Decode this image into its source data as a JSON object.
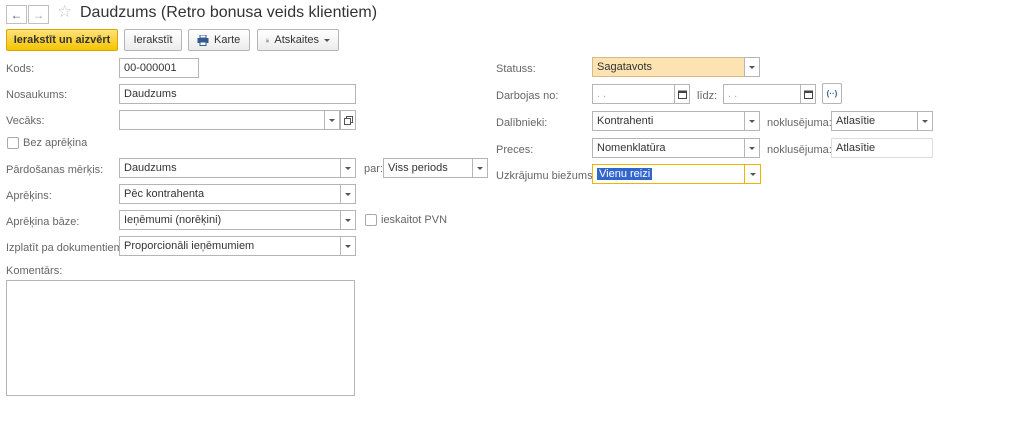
{
  "window": {
    "title": "Daudzums (Retro bonusa veids klientiem)"
  },
  "toolbar": {
    "save_close": "Ierakstīt un aizvērt",
    "save": "Ierakstīt",
    "print": "Karte",
    "reports": "Atskaites"
  },
  "left": {
    "code_label": "Kods:",
    "code_value": "00-000001",
    "name_label": "Nosaukums:",
    "name_value": "Daudzums",
    "parent_label": "Vecāks:",
    "parent_value": "",
    "no_calc_label": "Bez aprēķina",
    "sales_goal_label": "Pārdošanas mērķis:",
    "sales_goal_value": "Daudzums",
    "par_label": "par:",
    "par_value": "Viss periods",
    "calc_label": "Aprēķins:",
    "calc_value": "Pēc kontrahenta",
    "calc_base_label": "Aprēķina bāze:",
    "calc_base_value": "Ieņēmumi (norēķini)",
    "incl_vat_label": "ieskaitot PVN",
    "pay_by_docs_label": "Izplatīt pa dokumentiem:",
    "pay_by_docs_value": "Proporcionāli ieņēmumiem",
    "comment_label": "Komentārs:"
  },
  "right": {
    "status_label": "Statuss:",
    "status_value": "Sagatavots",
    "active_from_label": "Darbojas no:",
    "date_placeholder": " .  .",
    "to_label": "līdz:",
    "participants_label": "Dalībnieki:",
    "participants_value": "Kontrahenti",
    "default_label_1": "noklusējuma:",
    "default_value_1": "Atlasītie",
    "goods_label": "Preces:",
    "goods_value": "Nomenklatūra",
    "default_label_2": "noklusējuma:",
    "default_value_2": "Atlasītie",
    "accum_freq_label": "Uzkrājumu biežums:",
    "accum_freq_value": "Vienu reizi"
  },
  "colors": {
    "primary_button": "#f5c400",
    "status_bg": "#fde3b2",
    "focus_border": "#f0b400",
    "selection": "#3366cc"
  }
}
